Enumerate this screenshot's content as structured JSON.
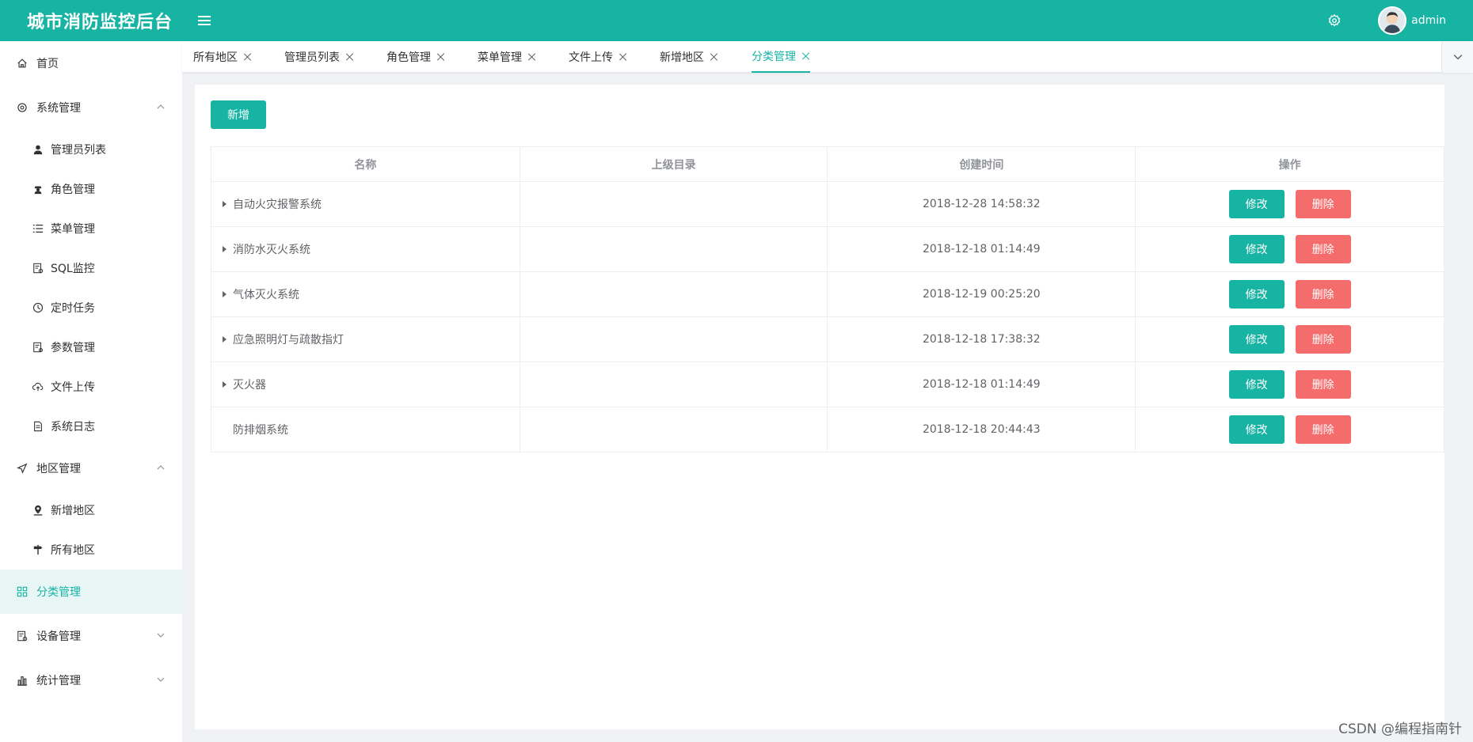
{
  "header": {
    "title": "城市消防监控后台",
    "username": "admin"
  },
  "sidebar": {
    "home": "首页",
    "system": {
      "label": "系统管理",
      "items": [
        "管理员列表",
        "角色管理",
        "菜单管理",
        "SQL监控",
        "定时任务",
        "参数管理",
        "文件上传",
        "系统日志"
      ]
    },
    "region": {
      "label": "地区管理",
      "items": [
        "新增地区",
        "所有地区"
      ]
    },
    "category": "分类管理",
    "device": "设备管理",
    "stats": "统计管理"
  },
  "tabs": [
    "所有地区",
    "管理员列表",
    "角色管理",
    "菜单管理",
    "文件上传",
    "新增地区",
    "分类管理"
  ],
  "main": {
    "add_label": "新增",
    "columns": [
      "名称",
      "上级目录",
      "创建时间",
      "操作"
    ],
    "edit_label": "修改",
    "delete_label": "删除",
    "rows": [
      {
        "name": "自动火灾报警系统",
        "parent": "",
        "created": "2018-12-28 14:58:32",
        "expandable": true
      },
      {
        "name": "消防水灭火系统",
        "parent": "",
        "created": "2018-12-18 01:14:49",
        "expandable": true
      },
      {
        "name": "气体灭火系统",
        "parent": "",
        "created": "2018-12-19 00:25:20",
        "expandable": true
      },
      {
        "name": "应急照明灯与疏散指灯",
        "parent": "",
        "created": "2018-12-18 17:38:32",
        "expandable": true
      },
      {
        "name": "灭火器",
        "parent": "",
        "created": "2018-12-18 01:14:49",
        "expandable": true
      },
      {
        "name": "防排烟系统",
        "parent": "",
        "created": "2018-12-18 20:44:43",
        "expandable": false
      }
    ]
  },
  "watermark": "CSDN @编程指南针",
  "colors": {
    "primary": "#17b3a3",
    "danger": "#f56c6c"
  }
}
